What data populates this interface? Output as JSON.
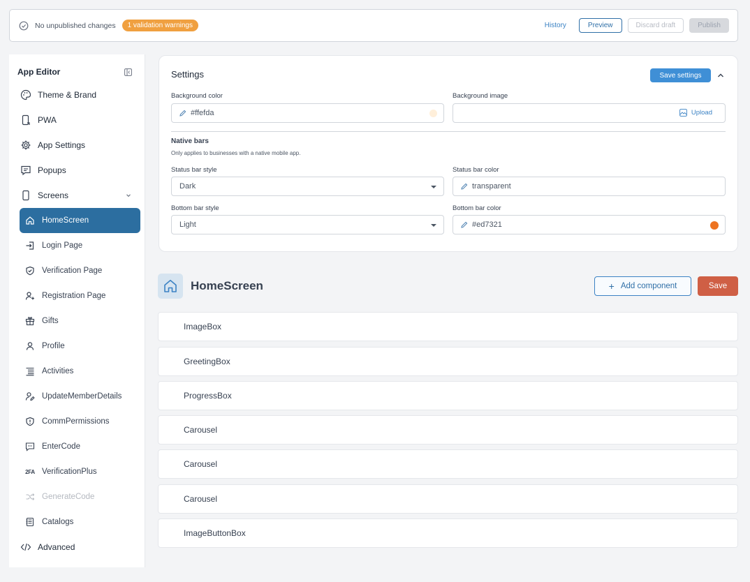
{
  "topbar": {
    "status": "No unpublished changes",
    "warning_badge": "1 validation warnings",
    "history": "History",
    "preview": "Preview",
    "discard": "Discard draft",
    "publish": "Publish"
  },
  "sidebar": {
    "title": "App Editor",
    "items": [
      {
        "label": "Theme & Brand",
        "icon": "palette-icon"
      },
      {
        "label": "PWA",
        "icon": "mobile-icon"
      },
      {
        "label": "App Settings",
        "icon": "gear-icon"
      },
      {
        "label": "Popups",
        "icon": "popup-icon"
      },
      {
        "label": "Screens",
        "icon": "phone-icon"
      }
    ],
    "screens": [
      {
        "label": "HomeScreen",
        "icon": "home-icon"
      },
      {
        "label": "Login Page",
        "icon": "login-icon"
      },
      {
        "label": "Verification Page",
        "icon": "shield-check-icon"
      },
      {
        "label": "Registration Page",
        "icon": "user-plus-icon"
      },
      {
        "label": "Gifts",
        "icon": "gift-icon"
      },
      {
        "label": "Profile",
        "icon": "user-icon"
      },
      {
        "label": "Activities",
        "icon": "list-icon"
      },
      {
        "label": "UpdateMemberDetails",
        "icon": "user-edit-icon"
      },
      {
        "label": "CommPermissions",
        "icon": "shield-alert-icon"
      },
      {
        "label": "EnterCode",
        "icon": "message-code-icon"
      },
      {
        "label": "VerificationPlus",
        "icon": "2fa-icon",
        "glyph": "2FA"
      },
      {
        "label": "GenerateCode",
        "icon": "shuffle-icon"
      },
      {
        "label": "Catalogs",
        "icon": "catalog-icon"
      }
    ],
    "advanced": {
      "label": "Advanced",
      "icon": "code-icon"
    }
  },
  "settings": {
    "title": "Settings",
    "save_button": "Save settings",
    "background_color_label": "Background color",
    "background_color": "#ffefda",
    "background_image_label": "Background image",
    "upload": "Upload",
    "native_bars_title": "Native bars",
    "native_bars_desc": "Only applies to businesses with a native mobile app.",
    "status_bar_style_label": "Status bar style",
    "status_bar_style": "Dark",
    "status_bar_color_label": "Status bar color",
    "status_bar_color": "transparent",
    "bottom_bar_style_label": "Bottom bar style",
    "bottom_bar_style": "Light",
    "bottom_bar_color_label": "Bottom bar color",
    "bottom_bar_color": "#ed7321"
  },
  "screen": {
    "title": "HomeScreen",
    "add_component": "Add component",
    "save": "Save",
    "components": [
      "ImageBox",
      "GreetingBox",
      "ProgressBox",
      "Carousel",
      "Carousel",
      "Carousel",
      "ImageButtonBox"
    ]
  },
  "colors": {
    "primary": "#2c6ea0",
    "accent": "#3f8fd6",
    "save": "#cf5f45",
    "warning": "#f0a040"
  }
}
